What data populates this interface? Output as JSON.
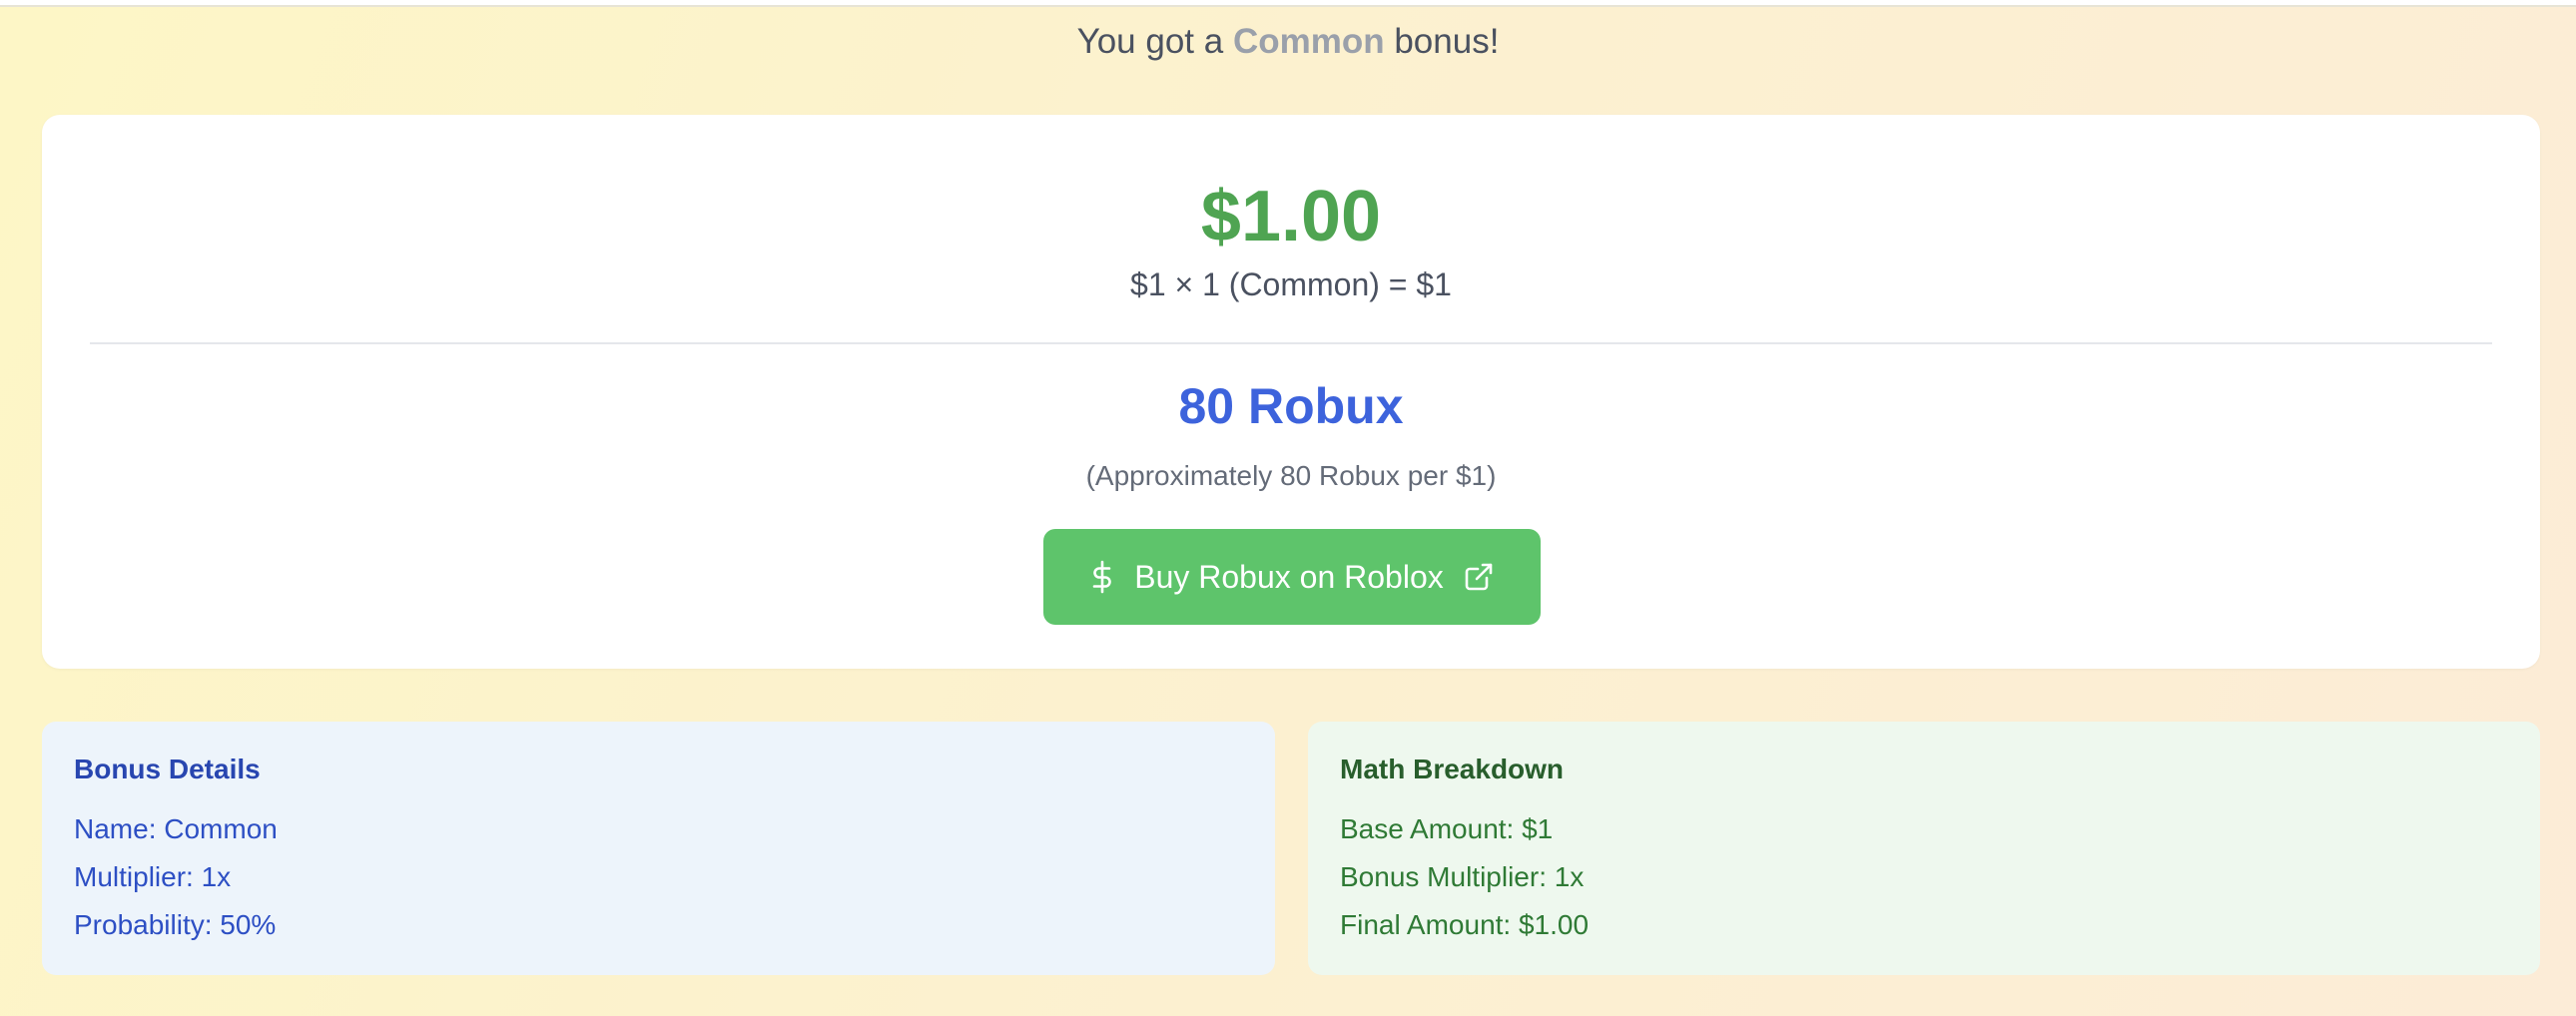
{
  "headline": {
    "prefix": "You got a",
    "rarity": "Common",
    "suffix": "bonus!",
    "rarity_color": "#9aa0aa"
  },
  "result_card": {
    "amount": "$1.00",
    "formula": "$1 × 1 (Common) = $1",
    "robux": "80 Robux",
    "rate_note": "(Approximately 80 Robux per $1)",
    "buy_button": {
      "label": "Buy Robux on Roblox",
      "leading_icon": "dollar-icon",
      "trailing_icon": "external-link-icon"
    }
  },
  "bonus_details": {
    "title": "Bonus Details",
    "name": "Name: Common",
    "multiplier": "Multiplier: 1x",
    "probability": "Probability: 50%"
  },
  "math_breakdown": {
    "title": "Math Breakdown",
    "base_amount": "Base Amount: $1",
    "bonus_multiplier": "Bonus Multiplier: 1x",
    "final_amount": "Final Amount: $1.00"
  },
  "colors": {
    "amount_green": "#4fa452",
    "robux_blue": "#3d63dc",
    "button_green": "#5ec46b",
    "bonus_panel_bg": "#edf4fb",
    "math_panel_bg": "#eef8ee"
  }
}
